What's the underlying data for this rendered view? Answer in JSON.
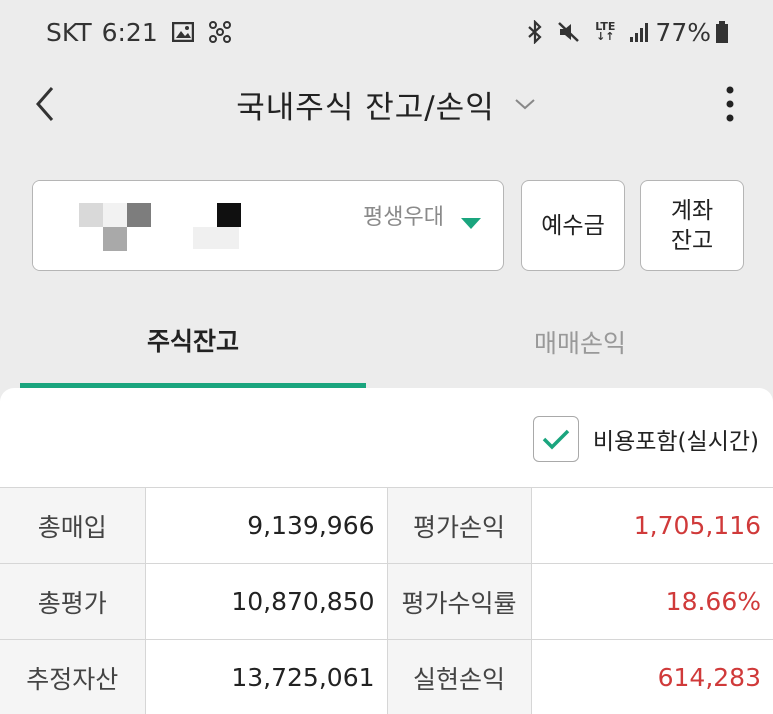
{
  "status_bar": {
    "carrier": "SKT",
    "time": "6:21",
    "network": "LTE",
    "battery": "77%"
  },
  "header": {
    "title": "국내주식 잔고/손익"
  },
  "account": {
    "type_label": "평생우대"
  },
  "buttons": {
    "deposit": "예수금",
    "account_balance_line1": "계좌",
    "account_balance_line2": "잔고"
  },
  "tabs": [
    {
      "label": "주식잔고",
      "active": true
    },
    {
      "label": "매매손익",
      "active": false
    }
  ],
  "options": {
    "include_cost_label": "비용포함(실시간)",
    "include_cost_checked": true
  },
  "summary": [
    {
      "label_left": "총매입",
      "value_left": "9,139,966",
      "label_right": "평가손익",
      "value_right": "1,705,116"
    },
    {
      "label_left": "총평가",
      "value_left": "10,870,850",
      "label_right": "평가수익률",
      "value_right": "18.66%"
    },
    {
      "label_left": "추정자산",
      "value_left": "13,725,061",
      "label_right": "실현손익",
      "value_right": "614,283"
    }
  ],
  "colors": {
    "accent": "#1aa57e",
    "profit_red": "#d03a3a"
  }
}
